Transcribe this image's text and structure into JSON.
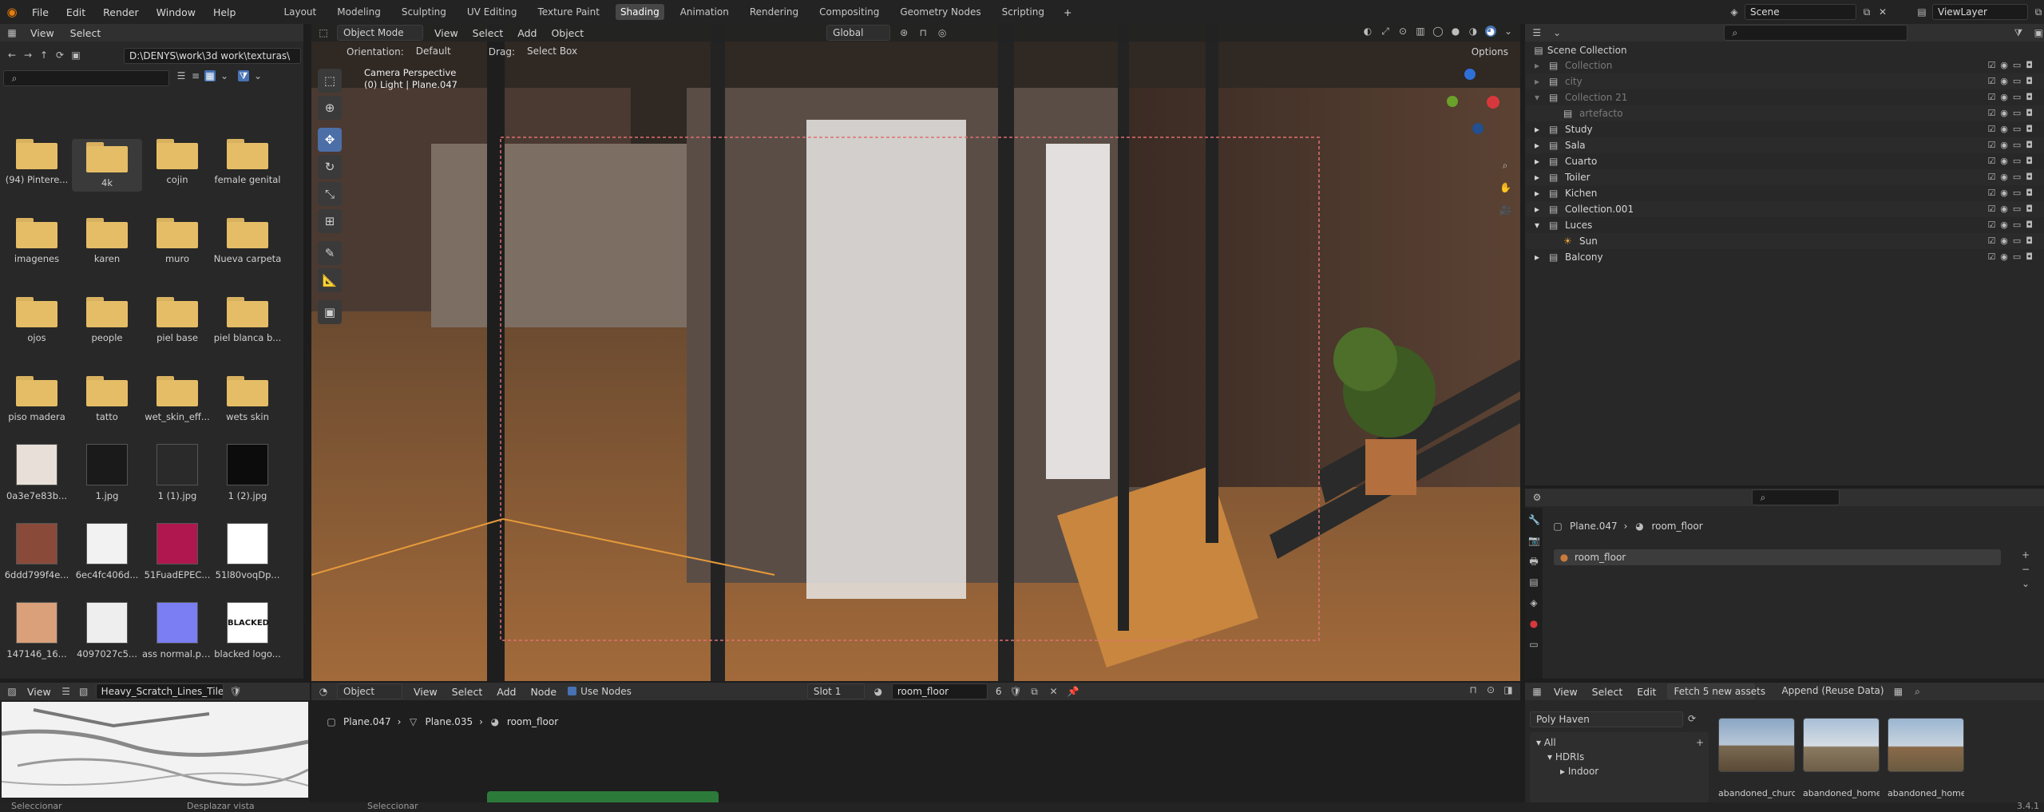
{
  "topbar": {
    "menus": [
      "File",
      "Edit",
      "Render",
      "Window",
      "Help"
    ],
    "workspaces": [
      "Layout",
      "Modeling",
      "Sculpting",
      "UV Editing",
      "Texture Paint",
      "Shading",
      "Animation",
      "Rendering",
      "Compositing",
      "Geometry Nodes",
      "Scripting"
    ],
    "active_workspace": "Shading",
    "scene": "Scene",
    "view_layer": "ViewLayer"
  },
  "filebrowser": {
    "menus": [
      "View",
      "Select"
    ],
    "path": "D:\\DENYS\\work\\3d work\\texturas\\",
    "items": [
      {
        "label": "(94) Pintere...",
        "kind": "folder"
      },
      {
        "label": "4k",
        "kind": "folder"
      },
      {
        "label": "cojin",
        "kind": "folder"
      },
      {
        "label": "female genital",
        "kind": "folder"
      },
      {
        "label": "imagenes",
        "kind": "folder"
      },
      {
        "label": "karen",
        "kind": "folder"
      },
      {
        "label": "muro",
        "kind": "folder"
      },
      {
        "label": "Nueva carpeta",
        "kind": "folder"
      },
      {
        "label": "ojos",
        "kind": "folder"
      },
      {
        "label": "people",
        "kind": "folder"
      },
      {
        "label": "piel base",
        "kind": "folder"
      },
      {
        "label": "piel blanca b...",
        "kind": "folder"
      },
      {
        "label": "piso madera",
        "kind": "folder"
      },
      {
        "label": "tatto",
        "kind": "folder"
      },
      {
        "label": "wet_skin_eff...",
        "kind": "folder"
      },
      {
        "label": "wets skin",
        "kind": "folder"
      },
      {
        "label": "0a3e7e83b...",
        "kind": "image",
        "color": "#e8e0d8"
      },
      {
        "label": "1.jpg",
        "kind": "image",
        "color": "#1a1a1a"
      },
      {
        "label": "1 (1).jpg",
        "kind": "image",
        "color": "#2a2a2a"
      },
      {
        "label": "1 (2).jpg",
        "kind": "image",
        "color": "#0c0c0c"
      },
      {
        "label": "6ddd799f4e...",
        "kind": "image",
        "color": "#8a4a3a"
      },
      {
        "label": "6ec4fc406d...",
        "kind": "image",
        "color": "#f2f2f2"
      },
      {
        "label": "51FuadEPEC...",
        "kind": "image",
        "color": "#b0174e"
      },
      {
        "label": "51l80voqDp...",
        "kind": "image",
        "color": "#ffffff"
      },
      {
        "label": "147146_16...",
        "kind": "image",
        "color": "#d9a07a"
      },
      {
        "label": "4097027c5...",
        "kind": "image",
        "color": "#eeeeee"
      },
      {
        "label": "ass normal.png",
        "kind": "image",
        "color": "#7a7ef2"
      },
      {
        "label": "blacked logo...",
        "kind": "image",
        "color": "#ffffff"
      }
    ],
    "blacked_text": "BLACKED"
  },
  "viewport": {
    "menus": [
      "View",
      "Select",
      "Add",
      "Object"
    ],
    "mode": "Object Mode",
    "orientation_label": "Orientation:",
    "orientation_value": "Default",
    "drag_label": "Drag:",
    "drag_value": "Select Box",
    "transform": "Global",
    "options": "Options",
    "overlay_line1": "Camera Perspective",
    "overlay_line2": "(0) Light | Plane.047"
  },
  "outliner": {
    "title": "Scene Collection",
    "rows": [
      {
        "name": "Collection",
        "indent": 1,
        "dim": true
      },
      {
        "name": "city",
        "indent": 1,
        "dim": true
      },
      {
        "name": "Collection 21",
        "indent": 1,
        "dim": true
      },
      {
        "name": "artefacto",
        "indent": 2,
        "dim": true
      },
      {
        "name": "Study",
        "indent": 1,
        "dim": false
      },
      {
        "name": "Sala",
        "indent": 1,
        "dim": false
      },
      {
        "name": "Cuarto",
        "indent": 1,
        "dim": false
      },
      {
        "name": "Toiler",
        "indent": 1,
        "dim": false
      },
      {
        "name": "Kichen",
        "indent": 1,
        "dim": false
      },
      {
        "name": "Collection.001",
        "indent": 1,
        "dim": false
      },
      {
        "name": "Luces",
        "indent": 1,
        "dim": false
      },
      {
        "name": "Sun",
        "indent": 2,
        "dim": false
      },
      {
        "name": "Balcony",
        "indent": 1,
        "dim": false
      }
    ]
  },
  "properties": {
    "object": "Plane.047",
    "material": "room_floor",
    "slot_material": "room_floor"
  },
  "shader": {
    "object_dropdown": "Object",
    "menus": [
      "View",
      "Select",
      "Add",
      "Node"
    ],
    "use_nodes": "Use Nodes",
    "slot": "Slot 1",
    "material": "room_floor",
    "users": "6",
    "breadcrumb": [
      "Plane.047",
      "Plane.035",
      "room_floor"
    ]
  },
  "imgeditor": {
    "menu": "View",
    "image_name": "Heavy_Scratch_Lines_Tiled.jpg"
  },
  "assetbrowser": {
    "menus": [
      "View",
      "Select",
      "Edit"
    ],
    "fetch": "Fetch 5 new assets",
    "import": "Append (Reuse Data)",
    "library": "Poly Haven",
    "tree": [
      "All",
      "HDRIs",
      "Indoor"
    ],
    "assets": [
      "abandoned_church",
      "abandoned_home",
      "abandoned_home"
    ]
  },
  "status": {
    "left": "Seleccionar",
    "middle": "Desplazar vista",
    "right": "Seleccionar",
    "version": "3.4.1"
  }
}
